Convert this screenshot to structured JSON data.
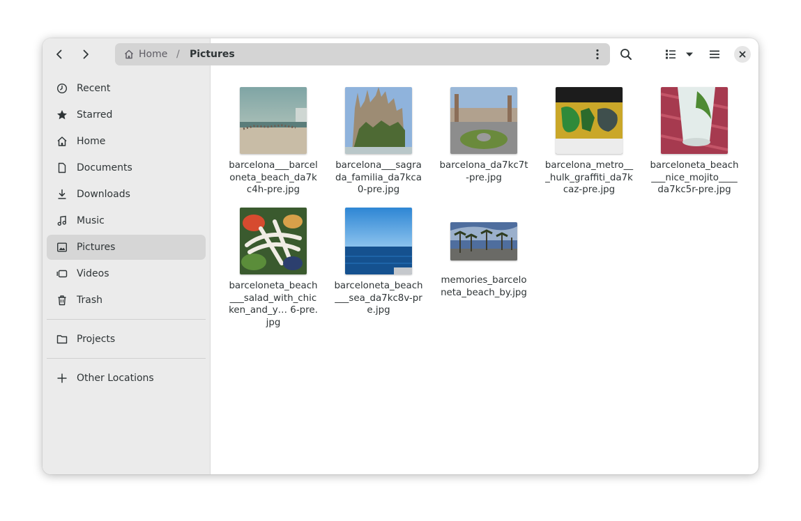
{
  "header": {
    "back_label": "Back",
    "forward_label": "Forward",
    "breadcrumb": {
      "home": "Home",
      "separator": "/",
      "current": "Pictures"
    }
  },
  "sidebar": {
    "items": [
      {
        "label": "Recent",
        "icon": "clock-icon"
      },
      {
        "label": "Starred",
        "icon": "star-icon"
      },
      {
        "label": "Home",
        "icon": "home-icon"
      },
      {
        "label": "Documents",
        "icon": "document-icon"
      },
      {
        "label": "Downloads",
        "icon": "download-icon"
      },
      {
        "label": "Music",
        "icon": "music-icon"
      },
      {
        "label": "Pictures",
        "icon": "image-icon",
        "active": true
      },
      {
        "label": "Videos",
        "icon": "video-icon"
      },
      {
        "label": "Trash",
        "icon": "trash-icon"
      }
    ],
    "bookmarks": [
      {
        "label": "Projects",
        "icon": "folder-icon"
      }
    ],
    "other": {
      "label": "Other Locations",
      "icon": "plus-icon"
    }
  },
  "files": [
    {
      "name": "barcelona___barceloneta_beach_da7kc4h-pre.jpg"
    },
    {
      "name": "barcelona___sagrada_familia_da7kca0-pre.jpg"
    },
    {
      "name": "barcelona_da7kc7t-pre.jpg"
    },
    {
      "name": "barcelona_metro___hulk_graffiti_da7kcaz-pre.jpg"
    },
    {
      "name": "barceloneta_beach___nice_mojito____da7kc5r-pre.jpg"
    },
    {
      "name": "barceloneta_beach___salad_with_chicken_and_y… 6-pre.jpg"
    },
    {
      "name": "barceloneta_beach___sea_da7kc8v-pre.jpg"
    },
    {
      "name": "memories_barceloneta_beach_by.jpg"
    }
  ],
  "colors": {
    "sidebar_bg": "#ebebeb",
    "pathbar_bg": "#d4d4d4",
    "active_item": "#d6d6d6"
  }
}
